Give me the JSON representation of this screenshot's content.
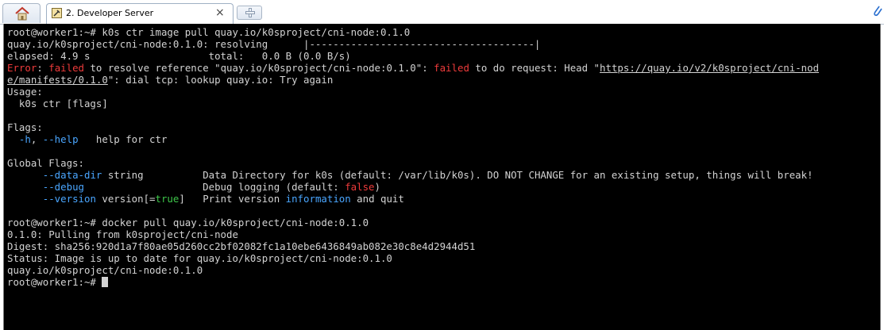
{
  "tabs": {
    "home_icon": "home-icon",
    "active_tab_label": "2. Developer Server",
    "close_glyph": "×",
    "new_tab_icon": "new-tab-icon",
    "corner_icon": "link-icon"
  },
  "terminal": {
    "background": "#000000",
    "foreground": "#d3d3d3",
    "error_color": "#ef3b3b",
    "option_color": "#4aa6ff",
    "bool_color": "#3ec74a",
    "l1": "root@worker1:~# k0s ctr image pull quay.io/k0sproject/cni-node:0.1.0",
    "l2": "quay.io/k0sproject/cni-node:0.1.0: resolving      |--------------------------------------|",
    "l3": "elapsed: 4.9 s                    total:   0.0 B (0.0 B/s)",
    "l4_a": "Error",
    "l4_b": ": ",
    "l4_c": "failed",
    "l4_d": " to resolve reference \"quay.io/k0sproject/cni-node:0.1.0\": ",
    "l4_e": "failed",
    "l4_f": " to do request: Head \"",
    "l4_g": "https://quay.io/v2/k0sproject/cni-nod",
    "l5_a": "e/manifests/0.1.0",
    "l5_b": "\": dial tcp: lookup quay.io: Try again",
    "l6": "Usage:",
    "l7": "  k0s ctr [flags]",
    "l8": "",
    "l9": "Flags:",
    "l10_a": "  ",
    "l10_b": "-h",
    "l10_c": ", ",
    "l10_d": "--help",
    "l10_e": "   help for ctr",
    "l11": "",
    "l12": "Global Flags:",
    "l13_a": "      ",
    "l13_b": "--data-dir",
    "l13_c": " string          Data Directory for k0s (default: /var/lib/k0s). DO NOT CHANGE for an existing setup, things will break!",
    "l14_a": "      ",
    "l14_b": "--debug",
    "l14_c": "                    Debug logging (default: ",
    "l14_d": "false",
    "l14_e": ")",
    "l15_a": "      ",
    "l15_b": "--version",
    "l15_c": " version[=",
    "l15_d": "true",
    "l15_e": "]   Print version ",
    "l15_f": "information",
    "l15_g": " and quit",
    "l16": "",
    "l17": "root@worker1:~# docker pull quay.io/k0sproject/cni-node:0.1.0",
    "l18": "0.1.0: Pulling from k0sproject/cni-node",
    "l19": "Digest: sha256:920d1a7f80ae05d260cc2bf02082fc1a10ebe6436849ab082e30c8e4d2944d51",
    "l20": "Status: Image is up to date for quay.io/k0sproject/cni-node:0.1.0",
    "l21": "quay.io/k0sproject/cni-node:0.1.0",
    "l22": "root@worker1:~# "
  }
}
